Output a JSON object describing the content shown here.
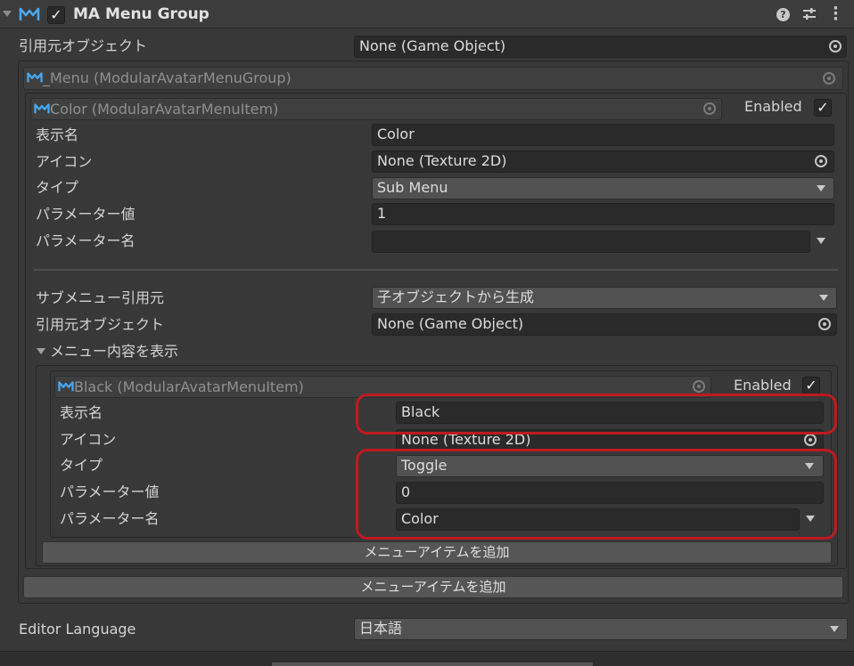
{
  "header": {
    "title": "MA Menu Group",
    "help_icon": "help-icon",
    "preset_icon": "preset-icon",
    "menu_icon": "kebab-menu-icon"
  },
  "group": {
    "source_label": "引用元オブジェクト",
    "source_value": "None (Game Object)",
    "menu_object": "_Menu (ModularAvatarMenuGroup)"
  },
  "color_item": {
    "object": "Color (ModularAvatarMenuItem)",
    "enabled_label": "Enabled",
    "display_name_label": "表示名",
    "display_name_value": "Color",
    "icon_label": "アイコン",
    "icon_value": "None (Texture 2D)",
    "type_label": "タイプ",
    "type_value": "Sub Menu",
    "param_value_label": "パラメーター値",
    "param_value": "1",
    "param_name_label": "パラメーター名",
    "param_name_value": "",
    "submenu_source_label": "サブメニュー引用元",
    "submenu_source_value": "子オブジェクトから生成",
    "source_object_label": "引用元オブジェクト",
    "source_object_value": "None (Game Object)",
    "show_contents_label": "メニュー内容を表示"
  },
  "black_item": {
    "object": "Black (ModularAvatarMenuItem)",
    "enabled_label": "Enabled",
    "display_name_label": "表示名",
    "display_name_value": "Black",
    "icon_label": "アイコン",
    "icon_value": "None (Texture 2D)",
    "type_label": "タイプ",
    "type_value": "Toggle",
    "param_value_label": "パラメーター値",
    "param_value": "0",
    "param_name_label": "パラメーター名",
    "param_name_value": "Color"
  },
  "buttons": {
    "add_item_inner": "メニューアイテムを追加",
    "add_item_outer": "メニューアイテムを追加"
  },
  "footer": {
    "language_label": "Editor Language",
    "language_value": "日本語"
  },
  "colors": {
    "highlight": "#c0191f",
    "logo": "#4aa8f0"
  }
}
